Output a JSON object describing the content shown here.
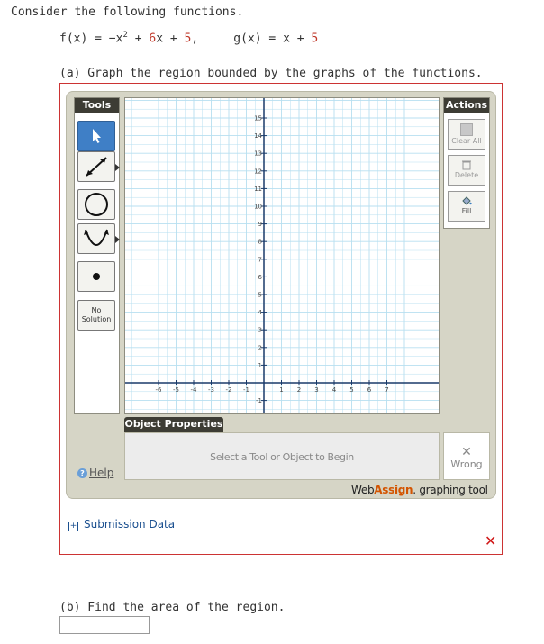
{
  "question": {
    "intro": "Consider the following functions.",
    "f_label": "f(x) = −x",
    "f_exp": "2",
    "f_plus1": " + ",
    "f_b": "6",
    "f_x": "x",
    "f_plus2": " + ",
    "f_c": "5",
    "f_comma": ",",
    "g_label": "g(x) = x + ",
    "g_c": "5",
    "part_a": "(a) Graph the region bounded by the graphs of the functions.",
    "part_b": "(b) Find the area of the region.",
    "answer_value": ""
  },
  "tool": {
    "tools_header": "Tools",
    "actions_header": "Actions",
    "buttons": [
      {
        "name": "pointer-tool-button",
        "icon": "pointer-icon"
      },
      {
        "name": "line-tool-button",
        "icon": "line-arrow-icon"
      },
      {
        "name": "circle-tool-button",
        "icon": "circle-icon"
      },
      {
        "name": "parabola-tool-button",
        "icon": "parabola-icon"
      },
      {
        "name": "point-tool-button",
        "icon": "point-icon"
      }
    ],
    "no_solution": {
      "line1": "No",
      "line2": "Solution"
    },
    "actions": {
      "clear_all": "Clear All",
      "delete": "Delete",
      "fill": "Fill"
    },
    "object_properties_header": "Object Properties",
    "object_properties_hint": "Select a Tool or Object to Begin",
    "wrong_label": "Wrong",
    "help_label": "Help",
    "brand_web": "Web",
    "brand_assign": "Assign",
    "brand_rest": ". graphing tool"
  },
  "graph": {
    "x_ticks": [
      -6,
      -5,
      -4,
      -3,
      -2,
      -1,
      1,
      2,
      3,
      4,
      5,
      6,
      7
    ],
    "y_ticks": [
      15,
      14,
      13,
      12,
      11,
      10,
      9,
      8,
      7,
      6,
      5,
      4,
      3,
      2,
      1,
      -1
    ],
    "grid_color": "#b7dff0",
    "axis_color": "#1a3a6a"
  },
  "submission": {
    "label": "Submission Data"
  },
  "colors": {
    "frame_red": "#cc3333",
    "tools_active": "#3f7fc6",
    "panel": "#d6d5c6",
    "brand_orange": "#d35400",
    "error_red": "#d01818"
  }
}
